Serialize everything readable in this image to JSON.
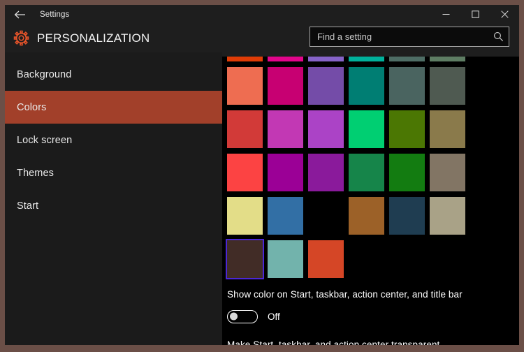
{
  "window": {
    "title": "Settings",
    "border_color": "#6b4f47",
    "back_icon": "back-arrow-icon",
    "minimize_label": "Minimize",
    "maximize_label": "Maximize",
    "close_label": "Close"
  },
  "header": {
    "icon": "gear-icon",
    "icon_color": "#e8542a",
    "title": "PERSONALIZATION"
  },
  "search": {
    "placeholder": "Find a setting",
    "value": "",
    "icon": "search-icon"
  },
  "sidebar": {
    "items": [
      {
        "label": "Background",
        "selected": false
      },
      {
        "label": "Colors",
        "selected": true
      },
      {
        "label": "Lock screen",
        "selected": false
      },
      {
        "label": "Themes",
        "selected": false
      },
      {
        "label": "Start",
        "selected": false
      }
    ],
    "selected_color": "#a2402a"
  },
  "colors": {
    "focus_outline": "#4b27d6",
    "focused_index": 24,
    "swatches": [
      {
        "hex": "#e03c06",
        "clipped": true
      },
      {
        "hex": "#e2058b",
        "clipped": true
      },
      {
        "hex": "#8663c8",
        "clipped": true
      },
      {
        "hex": "#00b19b",
        "clipped": true
      },
      {
        "hex": "#4e6d65",
        "clipped": true
      },
      {
        "hex": "#5e7d63",
        "clipped": true
      },
      {
        "hex": "#ee6d51"
      },
      {
        "hex": "#c70072"
      },
      {
        "hex": "#744ca8"
      },
      {
        "hex": "#007e73"
      },
      {
        "hex": "#4a6460"
      },
      {
        "hex": "#4f5a51"
      },
      {
        "hex": "#d23a38"
      },
      {
        "hex": "#c238b4"
      },
      {
        "hex": "#ab43c6"
      },
      {
        "hex": "#00cf72"
      },
      {
        "hex": "#4b7703"
      },
      {
        "hex": "#8a7a4b"
      },
      {
        "hex": "#fc4343"
      },
      {
        "hex": "#9b0096"
      },
      {
        "hex": "#8a1a9b"
      },
      {
        "hex": "#16854a"
      },
      {
        "hex": "#137c11"
      },
      {
        "hex": "#827564"
      },
      {
        "hex": "#e3dd88"
      },
      {
        "hex": "#326fa5"
      },
      {
        "hex": "#000000"
      },
      {
        "hex": "#9c6128"
      },
      {
        "hex": "#1f3d51"
      },
      {
        "hex": "#a9a287"
      },
      {
        "hex": "#412c26",
        "focused": true
      },
      {
        "hex": "#72b3ac"
      },
      {
        "hex": "#d54626"
      }
    ]
  },
  "settings": {
    "show_color_label": "Show color on Start, taskbar, action center, and title bar",
    "show_color_state": "Off",
    "show_color_on": false,
    "transparency_label": "Make Start, taskbar, and action center transparent"
  }
}
